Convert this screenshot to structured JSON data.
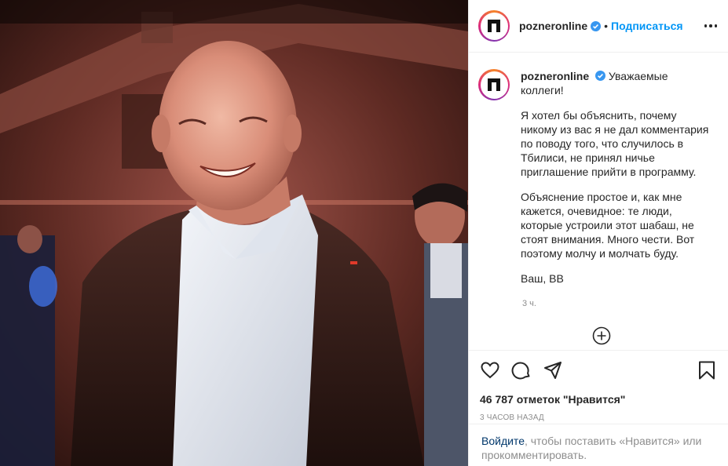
{
  "post": {
    "username": "pozneronline",
    "follow_label": "Подписаться",
    "avatar_letter": "п",
    "separator": "•"
  },
  "caption": {
    "username": "pozneronline",
    "greeting": "Уважаемые коллеги!",
    "paragraph1": "Я хотел бы объяснить, почему никому из вас я не дал комментария по поводу того, что случилось в Тбилиси, не принял ничье приглашение прийти в программу.",
    "paragraph2": "Объяснение простое и, как мне кажется, очевидное: те люди, которые устроили этот шабаш, не стоят внимания. Много чести. Вот поэтому молчу и молчать буду.",
    "signature": "Ваш, ВВ",
    "time": "3 ч."
  },
  "actions": {
    "likes": "46 787 отметок \"Нравится\"",
    "time": "3 ЧАСОВ НАЗАД"
  },
  "login_prompt": {
    "login_link": "Войдите",
    "rest": ", чтобы поставить «Нравится» или прокомментировать."
  },
  "icons": [
    "heart-icon",
    "comment-icon",
    "share-icon",
    "bookmark-icon",
    "more-icon",
    "plus-circle-icon",
    "verified-icon"
  ],
  "colors": {
    "accent": "#0095f6",
    "link_dark": "#00376b",
    "secondary_text": "#8e8e8e",
    "verified": "#3897f0"
  }
}
